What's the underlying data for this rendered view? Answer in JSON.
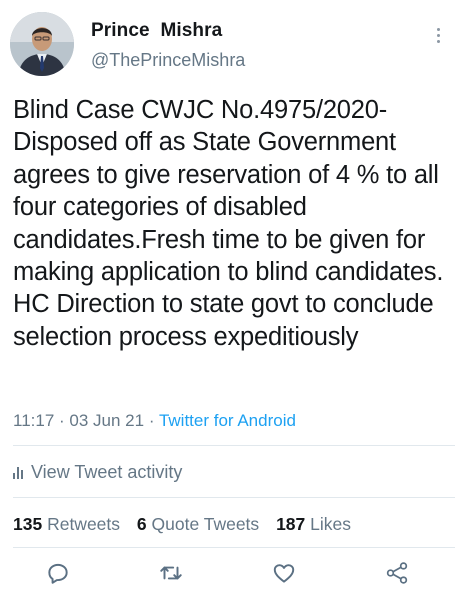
{
  "author": {
    "name": "Prince  Mishra",
    "handle": "@ThePrinceMishra"
  },
  "tweet": {
    "text": "Blind Case CWJC No.4975/2020- Disposed off as State Government agrees to give reservation of 4 % to all four categories of disabled candidates.Fresh time to be given for making application to blind candidates. HC Direction to state govt to conclude selection process expeditiously",
    "time": "11:17",
    "date": "03 Jun 21",
    "separator": "·",
    "source": "Twitter for Android"
  },
  "activity": {
    "label": "View Tweet activity",
    "icon": "bar-chart-icon"
  },
  "stats": {
    "retweets_count": "135",
    "retweets_label": "Retweets",
    "quotes_count": "6",
    "quotes_label": "Quote Tweets",
    "likes_count": "187",
    "likes_label": "Likes"
  },
  "actions": [
    {
      "icon": "reply-icon"
    },
    {
      "icon": "retweet-icon"
    },
    {
      "icon": "like-icon"
    },
    {
      "icon": "share-icon"
    }
  ],
  "colors": {
    "text": "#14171a",
    "secondary": "#657786",
    "link": "#1da1f2",
    "divider": "#e1e8ed",
    "action_icon": "#5b7083"
  }
}
